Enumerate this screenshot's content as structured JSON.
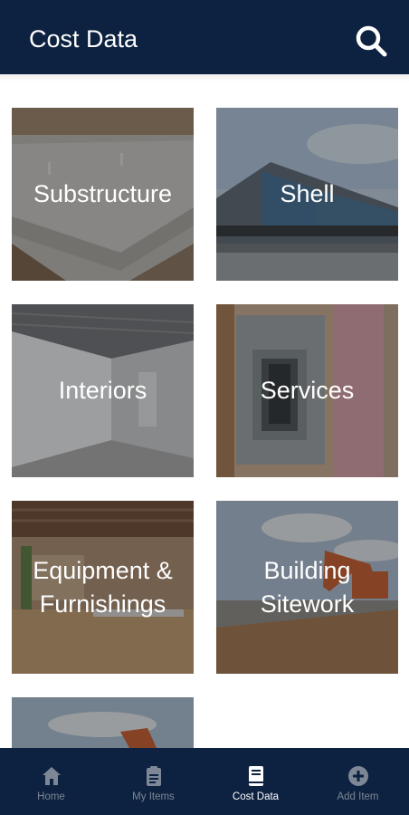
{
  "header": {
    "title": "Cost Data",
    "search_icon": "search-icon",
    "background": "#0d2240"
  },
  "categories": [
    {
      "label": "Substructure",
      "image": "concrete-slab-photo"
    },
    {
      "label": "Shell",
      "image": "building-exterior-photo"
    },
    {
      "label": "Interiors",
      "image": "unfinished-interior-photo"
    },
    {
      "label": "Services",
      "image": "electrical-panel-photo"
    },
    {
      "label": "Equipment &\nFurnishings",
      "image": "furnished-office-photo"
    },
    {
      "label": "Building\nSitework",
      "image": "excavator-site-photo"
    },
    {
      "label": "",
      "image": "excavator-sky-photo"
    }
  ],
  "bottom_nav": {
    "items": [
      {
        "label": "Home",
        "icon": "home-icon",
        "active": false
      },
      {
        "label": "My Items",
        "icon": "clipboard-icon",
        "active": false
      },
      {
        "label": "Cost Data",
        "icon": "book-icon",
        "active": true
      },
      {
        "label": "Add Item",
        "icon": "plus-circle-icon",
        "active": false
      }
    ],
    "active_color": "#ffffff",
    "inactive_color": "#7d8796"
  }
}
